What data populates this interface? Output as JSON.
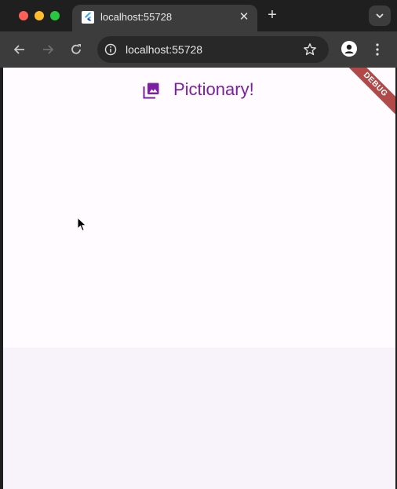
{
  "browser": {
    "tab": {
      "title": "localhost:55728",
      "favicon": "flutter-logo-icon",
      "close_glyph": "✕"
    },
    "new_tab_glyph": "+",
    "address_bar": {
      "url": "localhost:55728"
    },
    "icons": {
      "back": "arrow-left-icon",
      "forward": "arrow-right-icon",
      "reload": "reload-icon",
      "info": "info-icon",
      "star": "star-icon",
      "profile": "profile-icon",
      "menu": "kebab-icon",
      "tab_search": "chevron-down-icon"
    }
  },
  "app": {
    "title": "Pictionary!",
    "title_icon": "photo-library-icon",
    "debug_banner": "DEBUG",
    "accent_color": "#7b1fa2",
    "background_color": "#fffbfe",
    "panel_color": "#f8f2fa"
  }
}
